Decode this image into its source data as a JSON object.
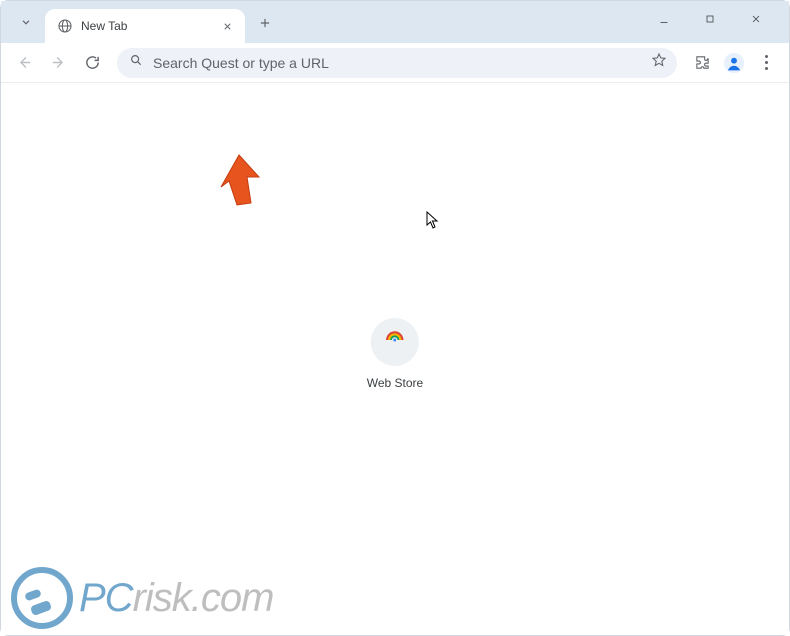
{
  "titlebar": {
    "tab_title": "New Tab"
  },
  "toolbar": {
    "omnibox_placeholder": "Search Quest or type a URL"
  },
  "content": {
    "shortcut_label": "Web Store"
  },
  "watermark": {
    "text_accent": "PC",
    "text_rest": "risk.com"
  }
}
